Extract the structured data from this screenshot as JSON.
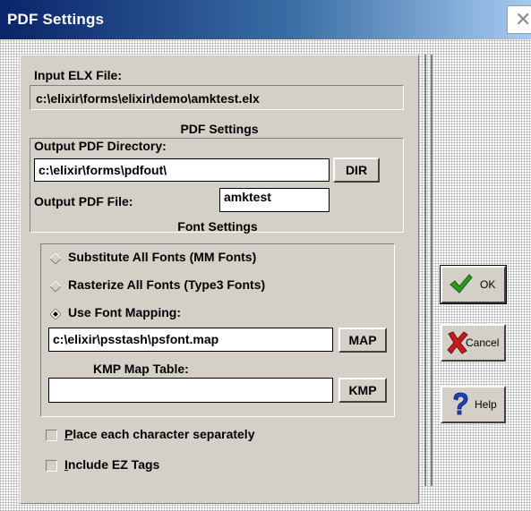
{
  "window": {
    "title": "PDF Settings",
    "close_glyph": "✕"
  },
  "input": {
    "label": "Input ELX File:",
    "value": "c:\\elixir\\forms\\elixir\\demo\\amktest.elx"
  },
  "pdf_settings": {
    "heading": "PDF Settings",
    "dir_label": "Output PDF Directory:",
    "dir_value": "c:\\elixir\\forms\\pdfout\\",
    "dir_button": "DIR",
    "file_label": "Output PDF File:",
    "file_value": "amktest"
  },
  "font_settings": {
    "heading": "Font Settings",
    "options": [
      {
        "label": "Substitute All Fonts (MM Fonts)",
        "selected": false
      },
      {
        "label": "Rasterize All Fonts (Type3 Fonts)",
        "selected": false
      },
      {
        "label": "Use Font Mapping:",
        "selected": true
      }
    ],
    "map_value": "c:\\elixir\\psstash\\psfont.map",
    "map_button": "MAP",
    "kmp_label": "KMP Map Table:",
    "kmp_value": "",
    "kmp_button": "KMP"
  },
  "checkboxes": [
    {
      "label": "Place each character separately",
      "checked": false
    },
    {
      "label": "Include EZ Tags",
      "checked": false
    }
  ],
  "buttons": {
    "ok": "OK",
    "cancel": "Cancel",
    "help": "Help"
  },
  "colors": {
    "ok_check": "#2e9a1a",
    "cancel_x": "#cc1b1b",
    "help_q": "#1f3fbf"
  }
}
